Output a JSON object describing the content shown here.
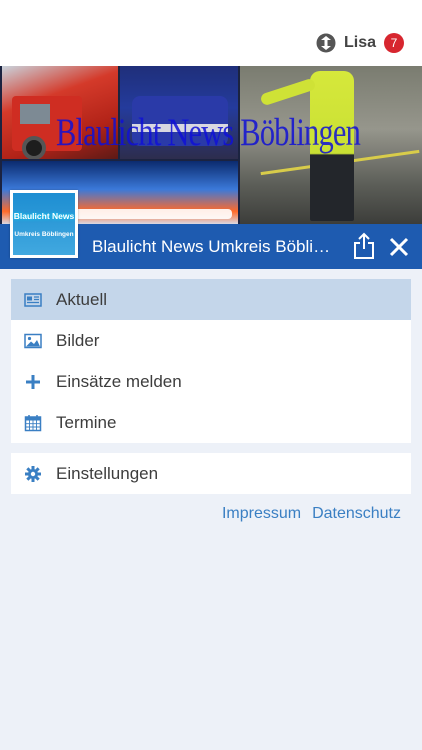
{
  "header": {
    "user_name": "Lisa",
    "notification_count": "7"
  },
  "banner": {
    "overlay_title": "Blaulicht News Böblingen",
    "logo_line1": "Blaulicht News",
    "logo_line2": "Umkreis Böblingen"
  },
  "titlebar": {
    "title": "Blaulicht News Umkreis Böblingen"
  },
  "menu": {
    "items": [
      {
        "label": "Aktuell",
        "icon": "newspaper-icon",
        "active": true
      },
      {
        "label": "Bilder",
        "icon": "image-icon",
        "active": false
      },
      {
        "label": "Einsätze melden",
        "icon": "plus-icon",
        "active": false
      },
      {
        "label": "Termine",
        "icon": "calendar-icon",
        "active": false
      }
    ],
    "settings": {
      "label": "Einstellungen",
      "icon": "gear-icon"
    }
  },
  "footer_links": {
    "impressum": "Impressum",
    "datenschutz": "Datenschutz"
  },
  "colors": {
    "accent": "#1e5bb0",
    "active_item": "#c4d6ea",
    "icon": "#3a7fc3",
    "badge": "#d7262f",
    "background": "#edf1f8"
  }
}
